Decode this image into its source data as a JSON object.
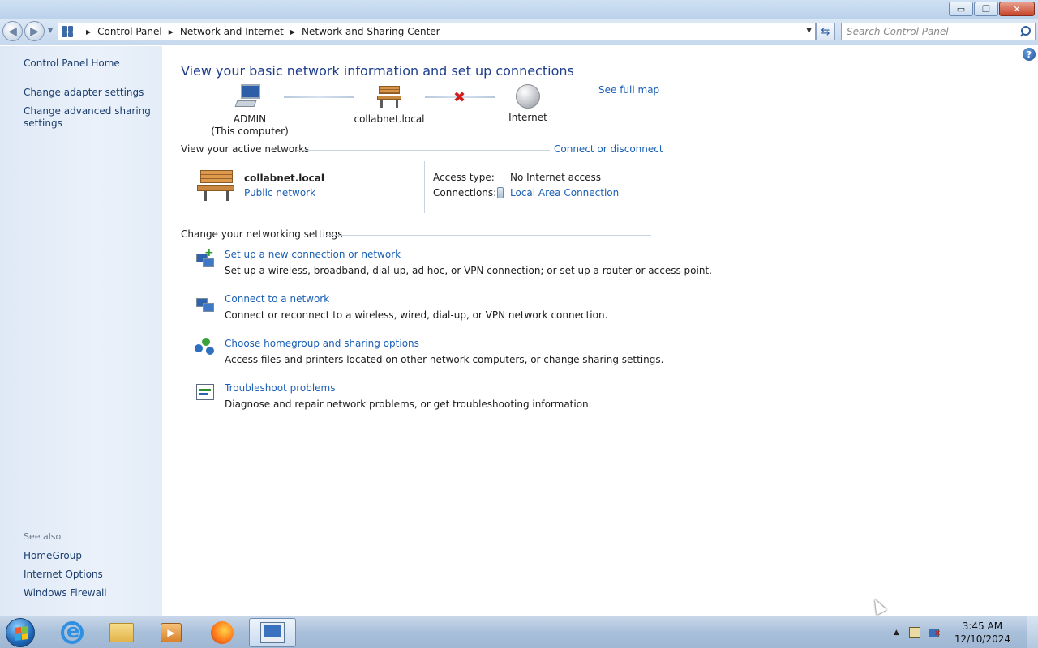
{
  "window": {
    "controls": {
      "minimize": "▭",
      "maximize": "❐",
      "close": "✕"
    }
  },
  "nav": {
    "back": "◀",
    "forward": "▶",
    "breadcrumb": [
      "Control Panel",
      "Network and Internet",
      "Network and Sharing Center"
    ],
    "search_placeholder": "Search Control Panel"
  },
  "sidebar": {
    "home": "Control Panel Home",
    "links": [
      "Change adapter settings",
      "Change advanced sharing settings"
    ],
    "see_also_heading": "See also",
    "see_also": [
      "HomeGroup",
      "Internet Options",
      "Windows Firewall"
    ]
  },
  "main": {
    "title": "View your basic network information and set up connections",
    "see_full_map": "See full map",
    "map": {
      "computer_name": "ADMIN",
      "computer_sub": "(This computer)",
      "network_name": "collabnet.local",
      "internet": "Internet"
    },
    "active_networks": {
      "heading": "View your active networks",
      "connect_link": "Connect or disconnect",
      "network_name": "collabnet.local",
      "network_type": "Public network",
      "access_type_label": "Access type:",
      "access_type_value": "No Internet access",
      "connections_label": "Connections:",
      "connections_value": "Local Area Connection"
    },
    "settings": {
      "heading": "Change your networking settings",
      "tasks": [
        {
          "title": "Set up a new connection or network",
          "desc": "Set up a wireless, broadband, dial-up, ad hoc, or VPN connection; or set up a router or access point."
        },
        {
          "title": "Connect to a network",
          "desc": "Connect or reconnect to a wireless, wired, dial-up, or VPN network connection."
        },
        {
          "title": "Choose homegroup and sharing options",
          "desc": "Access files and printers located on other network computers, or change sharing settings."
        },
        {
          "title": "Troubleshoot problems",
          "desc": "Diagnose and repair network problems, or get troubleshooting information."
        }
      ]
    }
  },
  "taskbar": {
    "clock_time": "3:45 AM",
    "clock_date": "12/10/2024"
  },
  "colors": {
    "link": "#1a5fb4",
    "title": "#1e3e8c",
    "sidebar_link": "#1c3f6e",
    "error_x": "#d21d1d"
  }
}
